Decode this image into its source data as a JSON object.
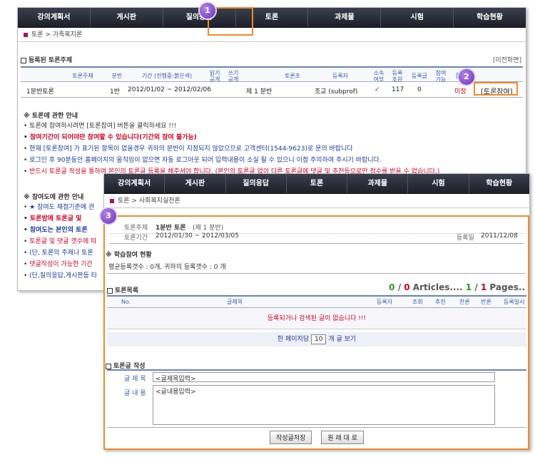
{
  "nav": [
    "강의계획서",
    "게시판",
    "질의응답",
    "토론",
    "과제물",
    "시험",
    "학습현황"
  ],
  "w1": {
    "crumb": "토론 > 가족복지론",
    "section_title": "등록된 토론주제",
    "prev_link": "[이전화면]",
    "cols": [
      "토론주제",
      "분반",
      "기간 (진행중:붉은색)",
      "읽기 공개",
      "쓰기 공개",
      "토론조",
      "등록자",
      "소속 여부",
      "등록 조원",
      "등록글",
      "참여 가능",
      "점"
    ],
    "row": {
      "topic": "1분반토론",
      "ban": "1반",
      "period": "2012/01/02 ~ 2012/02/06",
      "group": "제 1 분반",
      "author": "조교 (subprof)",
      "mark": "✓",
      "members": "117",
      "posts": "0",
      "status": "미정",
      "join_btn": "[토론참여]"
    },
    "guide_title": "※ 토론에 관한 안내",
    "guide": [
      {
        "text": "토론에 참여하시려면 [토론참여] 버튼을 클릭하세요 !!!",
        "style": "normal"
      },
      {
        "text": "참여기간이 되어야만 참여할 수 있습니다(기간외 참여 불가능)",
        "style": "red"
      },
      {
        "text": "현재 [토론참여] 가 표기된 항목이 없을경우 귀하의 분반이 지정되지 않았으므로 고객센터(1544-9623)로 문의 바랍니다",
        "style": "blue"
      },
      {
        "text": "로그인 후 90분동안 홈페이지의 움직임이 없으면 자동 로그아웃 되어 입력내용이 소실 될 수 있으니 이점 주의하여 주시기 바랍니다.",
        "style": "blue"
      },
      {
        "text": "반드시 토론글 작성을 통하여 본인의 토론글 등록을 해주셔야 합니다. (본인의 토론글 없이 다른 토론글에 댓글 및 추천등으로만 점수를 받을 수 없습니다.)",
        "style": "redn"
      }
    ],
    "part_title": "※ 참여도에 관한 안내",
    "part": [
      {
        "text": "★ 참여도 채점기준에 관",
        "style": "blue"
      },
      {
        "text": "토론방에 토론글 및",
        "style": "red"
      },
      {
        "text": "참여도는 본인의 토론",
        "style": "bluebold"
      },
      {
        "text": "토론글 및 댓글 갯수에 따",
        "style": "redn"
      },
      {
        "text": "(단, 토론의 주제나 토론",
        "style": "blue"
      },
      {
        "text": "댓글작성이 가능한 기간",
        "style": "redn"
      },
      {
        "text": "(단,질의응답,게시판등 타",
        "style": "blue"
      }
    ]
  },
  "w2": {
    "crumb": "토론 > 사회복지실천론",
    "topic_label": "토론주제",
    "topic_value": "1분반 토론",
    "topic_sub": "(제 1 분반)",
    "period_label": "토론기간",
    "period_value": "2012/01/30 ~ 2012/03/05",
    "reg_label": "등록일",
    "reg_value": "2011/12/08",
    "status_title": "※ 학습참여 현황",
    "status_text": "평균등록갯수 : 0개, 귀하의 등록갯수 : 0 개",
    "list_title": "토론목록",
    "count_a": "0",
    "count_sep": " / ",
    "count_b": "0",
    "count_articles": " Articles.... ",
    "count_c": "1",
    "count_d": "1",
    "count_pages": " Pages..",
    "cols": [
      "No.",
      "글제목",
      "등록자",
      "조회",
      "추천",
      "찬론",
      "반론",
      "등록일시"
    ],
    "empty_msg": "등록되거나 검색된 글이 없습니다 !!!",
    "per_page_prefix": "한 페이지당",
    "per_page_value": "10",
    "per_page_suffix": "개 글 보기",
    "write_title": "토론글 작성",
    "subject_label": "글 제 목",
    "subject_value": "<글제목입력>",
    "content_label": "글 내 용",
    "content_value": "<글내용입력>",
    "save_btn": "작성글저장",
    "reset_btn": "원 래 대 로"
  },
  "badges": [
    "1",
    "2",
    "3"
  ],
  "colors": {
    "accent_orange": "#f08a28",
    "badge_purple": "#7a3fc8",
    "alert_red": "#d1001f",
    "link_blue": "#1a3a9c"
  }
}
